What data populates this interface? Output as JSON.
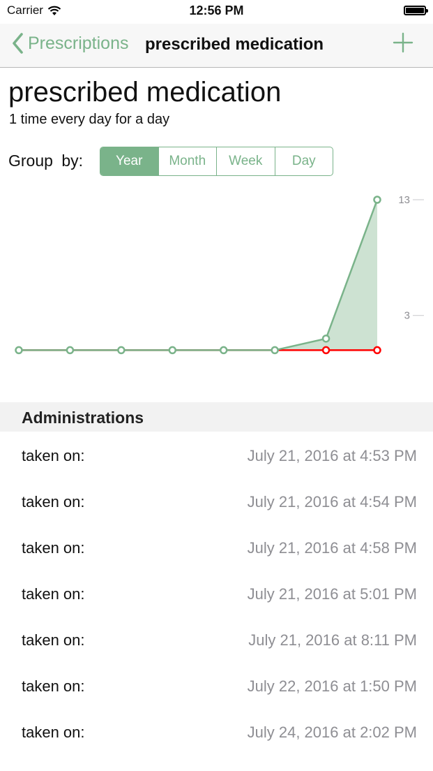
{
  "status_bar": {
    "carrier": "Carrier",
    "time": "12:56 PM"
  },
  "nav": {
    "back_label": "Prescriptions",
    "title": "prescribed medication"
  },
  "header": {
    "title": "prescribed medication",
    "subtitle": "1 time every day for a day"
  },
  "group_by": {
    "label": "Group by:",
    "options": [
      "Year",
      "Month",
      "Week",
      "Day"
    ],
    "selected": "Year"
  },
  "colors": {
    "accent": "#7ab38a",
    "fill": "#cde2d2",
    "target_line": "#ff0000",
    "tick_text": "#8e8e93"
  },
  "chart_data": {
    "type": "area",
    "series": [
      {
        "values": [
          0,
          0,
          0,
          0,
          0,
          0,
          1,
          13
        ]
      },
      {
        "values": [
          0,
          0,
          0,
          0,
          0,
          0,
          0,
          0
        ]
      }
    ],
    "yticks": [
      13,
      3
    ],
    "ylim": [
      -1,
      13
    ],
    "grid": false
  },
  "administrations": {
    "title": "Administrations",
    "items": [
      {
        "label": "taken on:",
        "value": "July 21, 2016 at 4:53 PM"
      },
      {
        "label": "taken on:",
        "value": "July 21, 2016 at 4:54 PM"
      },
      {
        "label": "taken on:",
        "value": "July 21, 2016 at 4:58 PM"
      },
      {
        "label": "taken on:",
        "value": "July 21, 2016 at 5:01 PM"
      },
      {
        "label": "taken on:",
        "value": "July 21, 2016 at 8:11 PM"
      },
      {
        "label": "taken on:",
        "value": "July 22, 2016 at 1:50 PM"
      },
      {
        "label": "taken on:",
        "value": "July 24, 2016 at 2:02 PM"
      }
    ]
  }
}
